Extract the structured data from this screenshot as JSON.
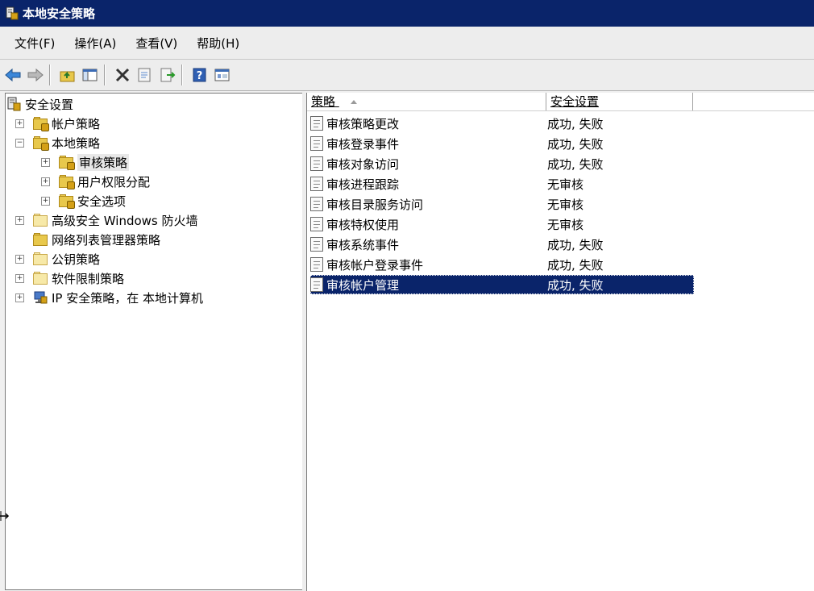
{
  "window": {
    "title": "本地安全策略"
  },
  "menu": [
    "文件(F)",
    "操作(A)",
    "查看(V)",
    "帮助(H)"
  ],
  "toolbar": {
    "buttons": [
      "back-icon",
      "forward-icon",
      "up-folder-icon",
      "show-hide-tree-icon",
      "delete-icon",
      "properties-icon",
      "export-list-icon",
      "help-icon",
      "view-icon"
    ]
  },
  "tree": {
    "root": "安全设置",
    "items": [
      {
        "label": "帐户策略",
        "level": 1,
        "expander": "+"
      },
      {
        "label": "本地策略",
        "level": 1,
        "expander": "−"
      },
      {
        "label": "审核策略",
        "level": 2,
        "expander": "+",
        "selected": true
      },
      {
        "label": "用户权限分配",
        "level": 2,
        "expander": "+"
      },
      {
        "label": "安全选项",
        "level": 2,
        "expander": "+"
      },
      {
        "label": "高级安全 Windows 防火墙",
        "level": 1,
        "expander": "+"
      },
      {
        "label": "网络列表管理器策略",
        "level": 1,
        "expander": ""
      },
      {
        "label": "公钥策略",
        "level": 1,
        "expander": "+"
      },
      {
        "label": "软件限制策略",
        "level": 1,
        "expander": "+"
      },
      {
        "label": "IP 安全策略，在 本地计算机",
        "level": 1,
        "expander": "+"
      }
    ]
  },
  "list": {
    "columns": [
      "策略",
      "安全设置"
    ],
    "rows": [
      {
        "policy": "审核策略更改",
        "setting": "成功, 失败"
      },
      {
        "policy": "审核登录事件",
        "setting": "成功, 失败"
      },
      {
        "policy": "审核对象访问",
        "setting": "成功, 失败"
      },
      {
        "policy": "审核进程跟踪",
        "setting": "无审核"
      },
      {
        "policy": "审核目录服务访问",
        "setting": "无审核"
      },
      {
        "policy": "审核特权使用",
        "setting": "无审核"
      },
      {
        "policy": "审核系统事件",
        "setting": "成功, 失败"
      },
      {
        "policy": "审核帐户登录事件",
        "setting": "成功, 失败"
      },
      {
        "policy": "审核帐户管理",
        "setting": "成功, 失败",
        "selected": true
      }
    ]
  },
  "colors": {
    "titlebar": "#0a246a",
    "selection": "#0a246a"
  }
}
